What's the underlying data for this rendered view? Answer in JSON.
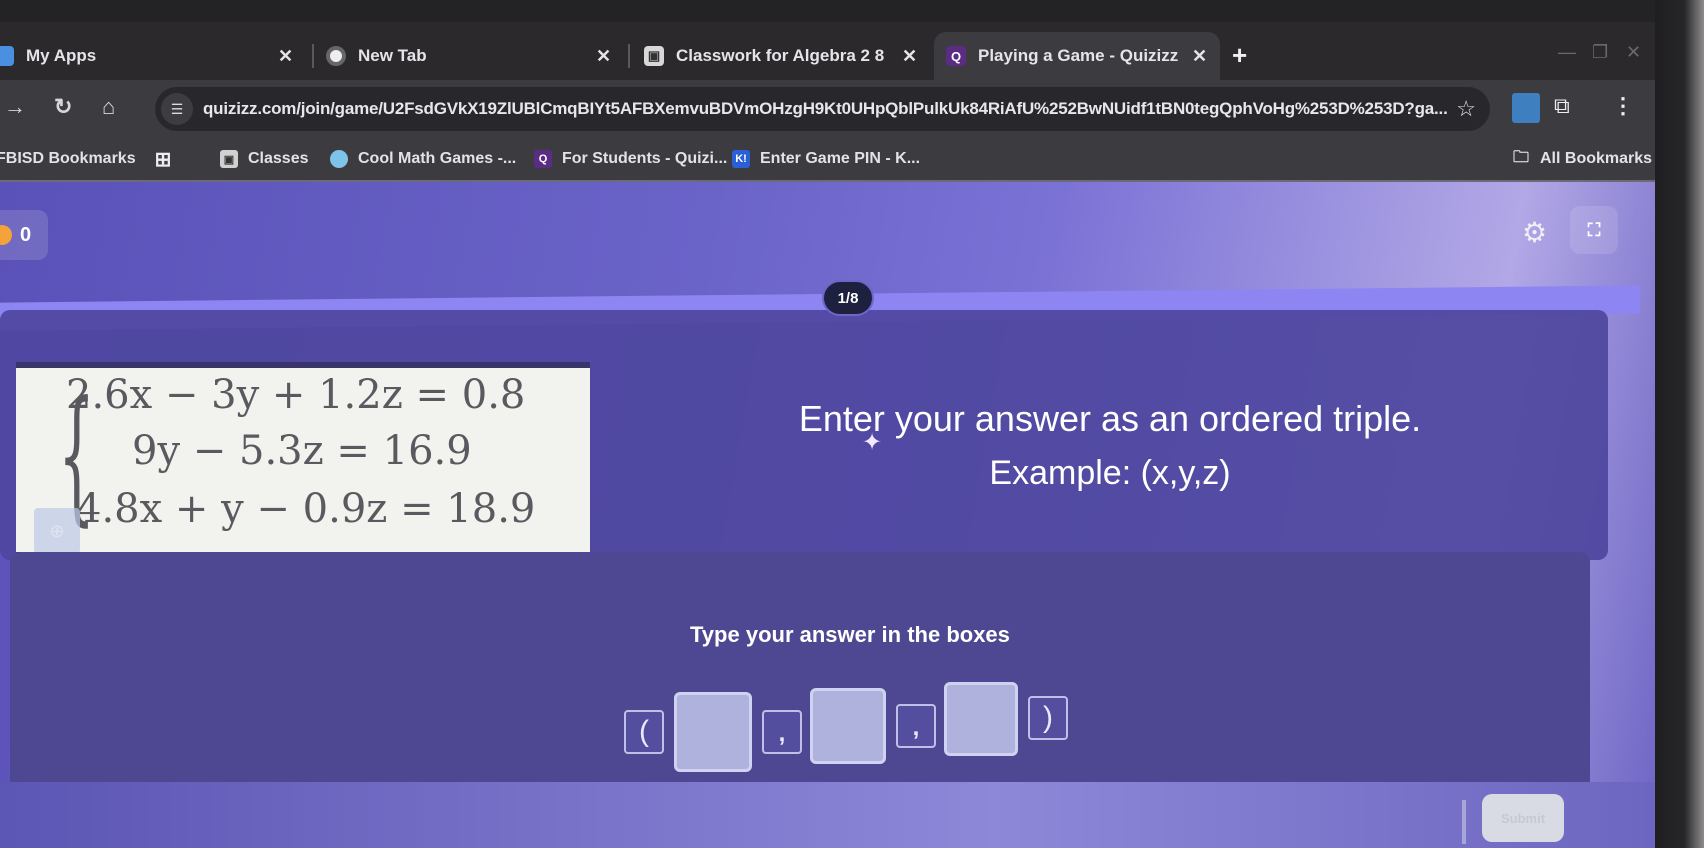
{
  "browser": {
    "tabs": [
      {
        "label": "My Apps",
        "icon": "my-apps-icon",
        "active": false
      },
      {
        "label": "New Tab",
        "icon": "chrome-icon",
        "active": false
      },
      {
        "label": "Classwork for Algebra 2 8",
        "icon": "classroom-icon",
        "active": false
      },
      {
        "label": "Playing a Game - Quizizz",
        "icon": "quizizz-icon",
        "active": true
      }
    ],
    "close_glyph": "✕",
    "new_tab_glyph": "+",
    "url": "quizizz.com/join/game/U2FsdGVkX19ZlUBlCmqBIYt5AFBXemvuBDVmOHzgH9Kt0UHpQblPulkUk84RiAfU%252BwNUidf1tBN0tegQphVoHg%253D%253D?ga...",
    "bookmarks": [
      {
        "label": "FBISD Bookmarks",
        "icon": "none"
      },
      {
        "label": "",
        "icon": "apps-grid-icon"
      },
      {
        "label": "Classes",
        "icon": "classroom-icon"
      },
      {
        "label": "Cool Math Games -...",
        "icon": "coolmath-icon"
      },
      {
        "label": "For Students - Quizi...",
        "icon": "quizizz-icon"
      },
      {
        "label": "Enter Game PIN - K...",
        "icon": "kahoot-icon"
      }
    ],
    "all_bookmarks": "All Bookmarks"
  },
  "game": {
    "score": "0",
    "progress": "1/8",
    "question": {
      "equations": [
        "2.6x − 3y + 1.2z = 0.8",
        "9y − 5.3z = 16.9",
        "4.8x + y − 0.9z = 18.9"
      ],
      "prompt_line1": "Enter your answer as an ordered triple.",
      "prompt_line2": "Example: (x,y,z)"
    },
    "answer": {
      "hint": "Type your answer in the boxes",
      "open_paren": "(",
      "close_paren": ")",
      "separator": ",",
      "x_value": "",
      "y_value": "",
      "z_value": ""
    },
    "submit_label": "Submit"
  }
}
